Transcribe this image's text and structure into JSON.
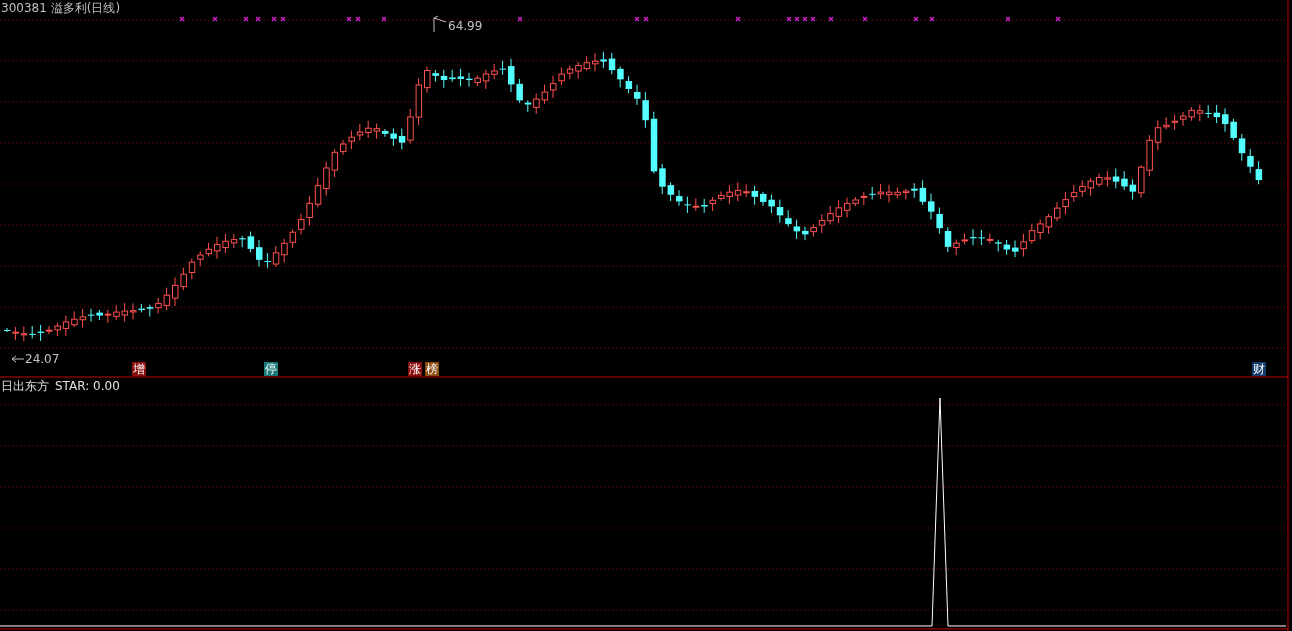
{
  "header": {
    "code": "300381",
    "name": "溢多利(日线)"
  },
  "price_chart": {
    "high_label": "64.99",
    "low_label": "24.07"
  },
  "event_badges": [
    {
      "text": "增",
      "color": "#8a1010"
    },
    {
      "text": "停",
      "color": "#1a7a7a"
    },
    {
      "text": "涨",
      "color": "#8a1010"
    },
    {
      "text": "榜",
      "color": "#8a4a10"
    },
    {
      "text": "财",
      "color": "#103a6a"
    }
  ],
  "indicator": {
    "name": "日出东方",
    "reading": "STAR: 0.00"
  }
}
